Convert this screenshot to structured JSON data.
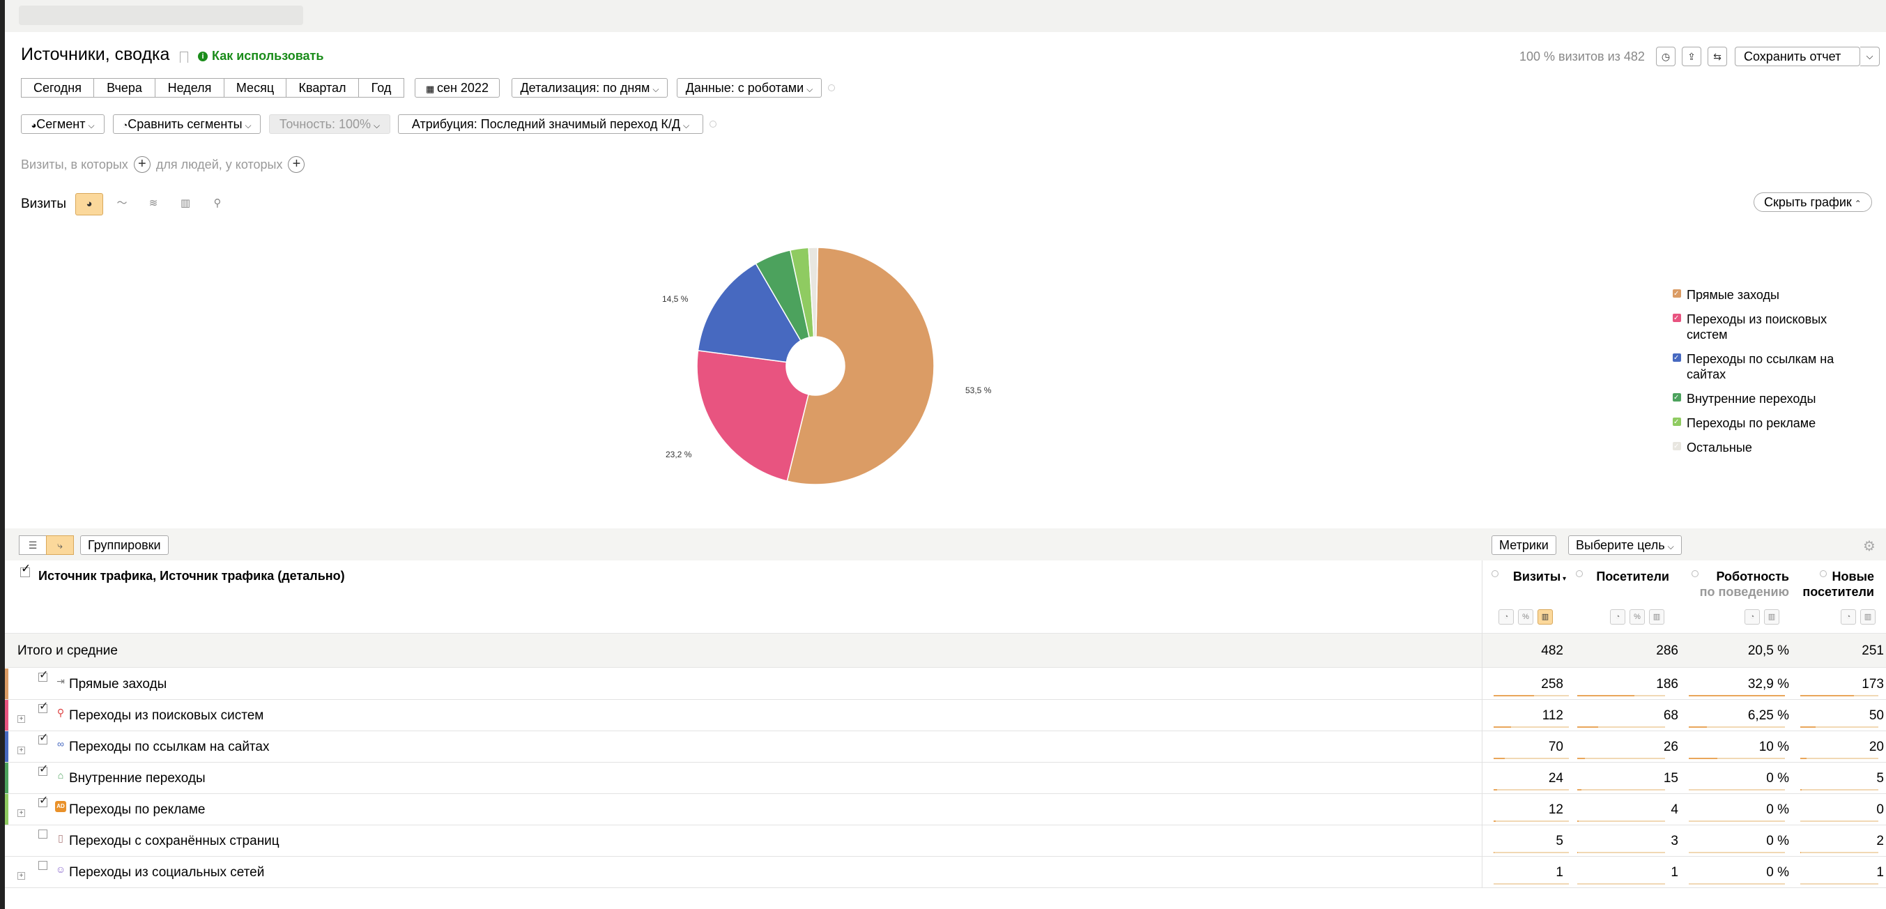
{
  "header": {
    "title": "Источники, сводка",
    "how_to_use": "Как использовать",
    "visits_ratio": "100 % визитов из 482",
    "save_report": "Сохранить отчет"
  },
  "period_buttons": [
    "Сегодня",
    "Вчера",
    "Неделя",
    "Месяц",
    "Квартал",
    "Год"
  ],
  "date_button": "сен 2022",
  "detail_button": "Детализация: по дням",
  "data_button": "Данные: с роботами",
  "segment_button": "Сегмент",
  "compare_button": "Сравнить сегменты",
  "accuracy_button": "Точность: 100%",
  "attribution_button": "Атрибуция: Последний значимый переход  К/Д",
  "filter": {
    "visits_where": "Визиты, в которых",
    "for_people": "для людей, у которых"
  },
  "chart_section": {
    "label": "Визиты",
    "hide_graph": "Скрыть график"
  },
  "chart_data": {
    "type": "pie",
    "donut": true,
    "slices": [
      {
        "name": "Прямые заходы",
        "value": 258,
        "label": "53,5 %",
        "color": "#DB9C65"
      },
      {
        "name": "Переходы из поисковых систем",
        "value": 112,
        "label": "23,2 %",
        "color": "#E85480"
      },
      {
        "name": "Переходы по ссылкам на сайтах",
        "value": 70,
        "label": "14,5 %",
        "color": "#4769C0"
      },
      {
        "name": "Внутренние переходы",
        "value": 24,
        "label": "",
        "color": "#4CA25D"
      },
      {
        "name": "Переходы по рекламе",
        "value": 12,
        "label": "",
        "color": "#8FCB61"
      },
      {
        "name": "Остальные",
        "value": 6,
        "label": "",
        "color": "#E8E6E0"
      }
    ],
    "legend_position": "right"
  },
  "legend": [
    {
      "label": "Прямые заходы",
      "color": "#DB9C65"
    },
    {
      "label": "Переходы из поисковых систем",
      "color": "#E85480"
    },
    {
      "label": "Переходы по ссылкам на сайтах",
      "color": "#4769C0"
    },
    {
      "label": "Внутренние переходы",
      "color": "#4CA25D"
    },
    {
      "label": "Переходы по рекламе",
      "color": "#8FCB61"
    },
    {
      "label": "Остальные",
      "color": "#E8E6E0"
    }
  ],
  "table_toolbar": {
    "groupings": "Группировки",
    "metrics": "Метрики",
    "choose_goal": "Выберите цель"
  },
  "table": {
    "dimension_header": "Источник трафика, Источник трафика (детально)",
    "columns": [
      {
        "title": "Визиты",
        "sub": ""
      },
      {
        "title": "Посетители",
        "sub": ""
      },
      {
        "title": "Роботность",
        "sub": "по поведению"
      },
      {
        "title": "Новые посетители",
        "sub": ""
      }
    ],
    "totals": {
      "label": "Итого и средние",
      "values": [
        "482",
        "286",
        "20,5 %",
        "251"
      ]
    },
    "rows": [
      {
        "label": "Прямые заходы",
        "checked": true,
        "expandable": false,
        "icon": "direct-icon",
        "color": "#DB9C65",
        "values": [
          "258",
          "186",
          "32,9 %",
          "173"
        ],
        "shares": [
          0.535,
          0.65,
          1.0,
          0.69
        ]
      },
      {
        "label": "Переходы из поисковых систем",
        "checked": true,
        "expandable": true,
        "icon": "search-icon",
        "color": "#E85480",
        "values": [
          "112",
          "68",
          "6,25 %",
          "50"
        ],
        "shares": [
          0.232,
          0.24,
          0.19,
          0.2
        ]
      },
      {
        "label": "Переходы по ссылкам на сайтах",
        "checked": true,
        "expandable": true,
        "icon": "link-icon",
        "color": "#4769C0",
        "values": [
          "70",
          "26",
          "10 %",
          "20"
        ],
        "shares": [
          0.145,
          0.09,
          0.3,
          0.08
        ]
      },
      {
        "label": "Внутренние переходы",
        "checked": true,
        "expandable": false,
        "icon": "home-icon",
        "color": "#4CA25D",
        "values": [
          "24",
          "15",
          "0 %",
          "5"
        ],
        "shares": [
          0.05,
          0.05,
          0,
          0.02
        ]
      },
      {
        "label": "Переходы по рекламе",
        "checked": true,
        "expandable": true,
        "icon": "ad-icon",
        "color": "#8FCB61",
        "values": [
          "12",
          "4",
          "0 %",
          "0"
        ],
        "shares": [
          0.025,
          0.014,
          0,
          0
        ]
      },
      {
        "label": "Переходы с сохранённых страниц",
        "checked": false,
        "expandable": false,
        "icon": "saved-page-icon",
        "color": "",
        "values": [
          "5",
          "3",
          "0 %",
          "2"
        ],
        "shares": [
          0.01,
          0.01,
          0,
          0.008
        ]
      },
      {
        "label": "Переходы из социальных сетей",
        "checked": false,
        "expandable": true,
        "icon": "social-icon",
        "color": "",
        "values": [
          "1",
          "1",
          "0 %",
          "1"
        ],
        "shares": [
          0.002,
          0.003,
          0,
          0.004
        ]
      }
    ]
  }
}
